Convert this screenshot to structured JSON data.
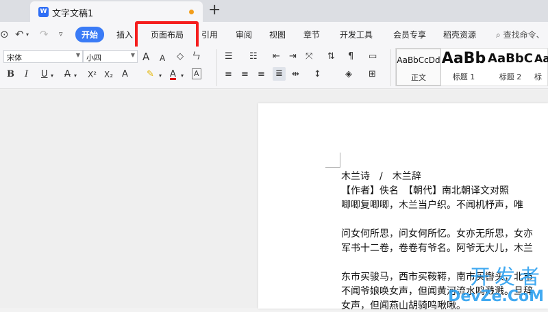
{
  "window": {
    "tab_title": "文字文稿1",
    "tab_icon": "wps-writer-icon",
    "unsaved_dot_color": "#f29d1b",
    "add_tab_label": "+"
  },
  "menubar": {
    "items": [
      "开始",
      "插入",
      "页面布局",
      "引用",
      "审阅",
      "视图",
      "章节",
      "开发工具",
      "会员专享",
      "稻壳资源"
    ],
    "active_index": 0,
    "search_text": "查找命令、"
  },
  "ribbon": {
    "font_name": "宋体",
    "font_size": "小四",
    "bold_label": "B",
    "italic_label": "I",
    "underline_label": "U",
    "strikethrough_label": "A",
    "superscript_label": "X²",
    "subscript_label": "X₂",
    "grow_font_label": "A",
    "shrink_font_label": "A",
    "font_color_label": "A",
    "char_border_label": "A",
    "text_effect_label": "A",
    "styles": [
      {
        "sample": "AaBbCcDd",
        "label": "正文"
      },
      {
        "sample": "AaBb",
        "label": "标题 1"
      },
      {
        "sample": "AaBbC",
        "label": "标题 2"
      },
      {
        "sample": "AaI",
        "label": "标"
      }
    ]
  },
  "document": {
    "lines": [
      "木兰诗　/　木兰辞",
      "【作者】佚名　【朝代】南北朝译文对照",
      "唧唧复唧唧，木兰当户织。不闻机杼声，唯",
      "",
      "问女何所思，问女何所忆。女亦无所思，女亦",
      "军书十二卷，卷卷有爷名。阿爷无大儿，木兰",
      "",
      "东市买骏马，西市买鞍鞯，南市买辔头，北市",
      "不闻爷娘唤女声，但闻黄河流水鸣溅溅。旦辞",
      "女声，但闻燕山胡骑鸣啾啾。"
    ]
  },
  "watermark": {
    "top": "开发者",
    "bottom": "DevZe.CoM"
  },
  "colors": {
    "accent": "#3a7bf6",
    "highlight_box": "#f51d1d",
    "watermark": "#2ca0f0"
  }
}
